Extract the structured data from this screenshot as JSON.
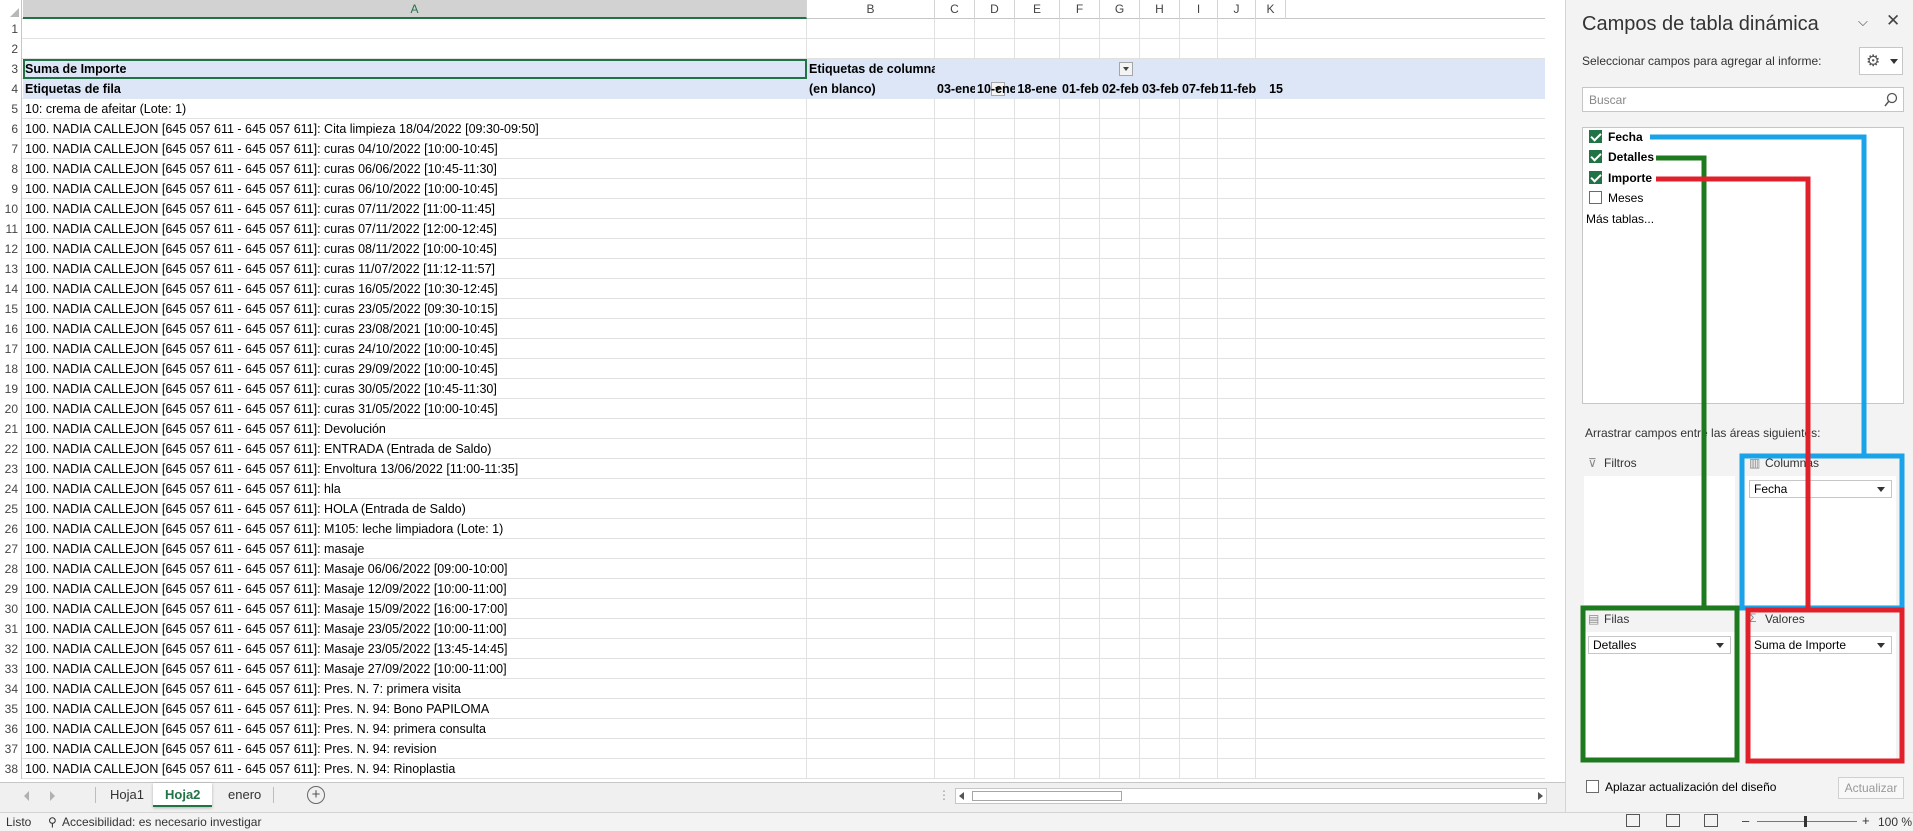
{
  "columns": [
    "A",
    "B",
    "C",
    "D",
    "E",
    "F",
    "G",
    "H",
    "I",
    "J",
    "K"
  ],
  "row_numbers": [
    "1",
    "2",
    "3",
    "4",
    "5",
    "6",
    "7",
    "8",
    "9",
    "10",
    "11",
    "12",
    "13",
    "14",
    "15",
    "16",
    "17",
    "18",
    "19",
    "20",
    "21",
    "22",
    "23",
    "24",
    "25",
    "26",
    "27",
    "28",
    "29",
    "30",
    "31",
    "32",
    "33",
    "34",
    "35",
    "36",
    "37",
    "38"
  ],
  "pivot": {
    "r3_a": "Suma de Importe",
    "r3_b": "Etiquetas de columna",
    "r4_a": "Etiquetas de fila",
    "r4_b": "(en blanco)",
    "date_headers": [
      "03-ene",
      "10-ene",
      "18-ene",
      "01-feb",
      "02-feb",
      "03-feb",
      "07-feb",
      "11-feb",
      "15"
    ],
    "rows": [
      "10: crema de afeitar (Lote: 1)",
      "100. NADIA CALLEJON [645 057 611 - 645 057 611]: Cita limpieza  18/04/2022  [09:30-09:50]",
      "100. NADIA CALLEJON [645 057 611 - 645 057 611]: curas  04/10/2022  [10:00-10:45]",
      "100. NADIA CALLEJON [645 057 611 - 645 057 611]: curas  06/06/2022  [10:45-11:30]",
      "100. NADIA CALLEJON [645 057 611 - 645 057 611]: curas  06/10/2022  [10:00-10:45]",
      "100. NADIA CALLEJON [645 057 611 - 645 057 611]: curas  07/11/2022  [11:00-11:45]",
      "100. NADIA CALLEJON [645 057 611 - 645 057 611]: curas  07/11/2022  [12:00-12:45]",
      "100. NADIA CALLEJON [645 057 611 - 645 057 611]: curas  08/11/2022  [10:00-10:45]",
      "100. NADIA CALLEJON [645 057 611 - 645 057 611]: curas  11/07/2022  [11:12-11:57]",
      "100. NADIA CALLEJON [645 057 611 - 645 057 611]: curas  16/05/2022  [10:30-12:45]",
      "100. NADIA CALLEJON [645 057 611 - 645 057 611]: curas  23/05/2022  [09:30-10:15]",
      "100. NADIA CALLEJON [645 057 611 - 645 057 611]: curas  23/08/2021  [10:00-10:45]",
      "100. NADIA CALLEJON [645 057 611 - 645 057 611]: curas  24/10/2022  [10:00-10:45]",
      "100. NADIA CALLEJON [645 057 611 - 645 057 611]: curas  29/09/2022  [10:00-10:45]",
      "100. NADIA CALLEJON [645 057 611 - 645 057 611]: curas  30/05/2022  [10:45-11:30]",
      "100. NADIA CALLEJON [645 057 611 - 645 057 611]: curas  31/05/2022  [10:00-10:45]",
      "100. NADIA CALLEJON [645 057 611 - 645 057 611]: Devolución",
      "100. NADIA CALLEJON [645 057 611 - 645 057 611]: ENTRADA (Entrada de Saldo)",
      "100. NADIA CALLEJON [645 057 611 - 645 057 611]: Envoltura  13/06/2022  [11:00-11:35]",
      "100. NADIA CALLEJON [645 057 611 - 645 057 611]: hla",
      "100. NADIA CALLEJON [645 057 611 - 645 057 611]: HOLA (Entrada de Saldo)",
      "100. NADIA CALLEJON [645 057 611 - 645 057 611]: M105: leche limpiadora (Lote: 1)",
      "100. NADIA CALLEJON [645 057 611 - 645 057 611]: masaje",
      "100. NADIA CALLEJON [645 057 611 - 645 057 611]: Masaje  06/06/2022  [09:00-10:00]",
      "100. NADIA CALLEJON [645 057 611 - 645 057 611]: Masaje  12/09/2022  [10:00-11:00]",
      "100. NADIA CALLEJON [645 057 611 - 645 057 611]: Masaje  15/09/2022  [16:00-17:00]",
      "100. NADIA CALLEJON [645 057 611 - 645 057 611]: Masaje  23/05/2022  [10:00-11:00]",
      "100. NADIA CALLEJON [645 057 611 - 645 057 611]: Masaje  23/05/2022  [13:45-14:45]",
      "100. NADIA CALLEJON [645 057 611 - 645 057 611]: Masaje  27/09/2022  [10:00-11:00]",
      "100. NADIA CALLEJON [645 057 611 - 645 057 611]: Pres. N. 7: primera visita",
      "100. NADIA CALLEJON [645 057 611 - 645 057 611]: Pres. N. 94: Bono PAPILOMA",
      "100. NADIA CALLEJON [645 057 611 - 645 057 611]: Pres. N. 94: primera consulta",
      "100. NADIA CALLEJON [645 057 611 - 645 057 611]: Pres. N. 94: revision",
      "100. NADIA CALLEJON [645 057 611 - 645 057 611]: Pres. N. 94: Rinoplastia"
    ]
  },
  "tabs": [
    "Hoja1",
    "Hoja2",
    "enero"
  ],
  "active_tab": "Hoja2",
  "status": {
    "ready": "Listo",
    "accessibility": "Accesibilidad: es necesario investigar",
    "zoom": "100 %"
  },
  "pane": {
    "title": "Campos de tabla dinámica",
    "subtitle": "Seleccionar campos para agregar al informe:",
    "search_placeholder": "Buscar",
    "fields": [
      {
        "label": "Fecha",
        "checked": true
      },
      {
        "label": "Detalles",
        "checked": true
      },
      {
        "label": "Importe",
        "checked": true
      },
      {
        "label": "Meses",
        "checked": false
      }
    ],
    "more_tables": "Más tablas...",
    "drag_text": "Arrastrar campos entre las áreas siguientes:",
    "areas": {
      "filters": "Filtros",
      "columns": "Columnas",
      "rows": "Filas",
      "values": "Valores"
    },
    "area_items": {
      "columns": "Fecha",
      "rows": "Detalles",
      "values": "Suma de Importe"
    },
    "defer_label": "Aplazar actualización del diseño",
    "update_button": "Actualizar"
  },
  "annotation_colors": {
    "fecha": "#1aa3e8",
    "detalles": "#1e7a1e",
    "importe": "#e0202a"
  }
}
